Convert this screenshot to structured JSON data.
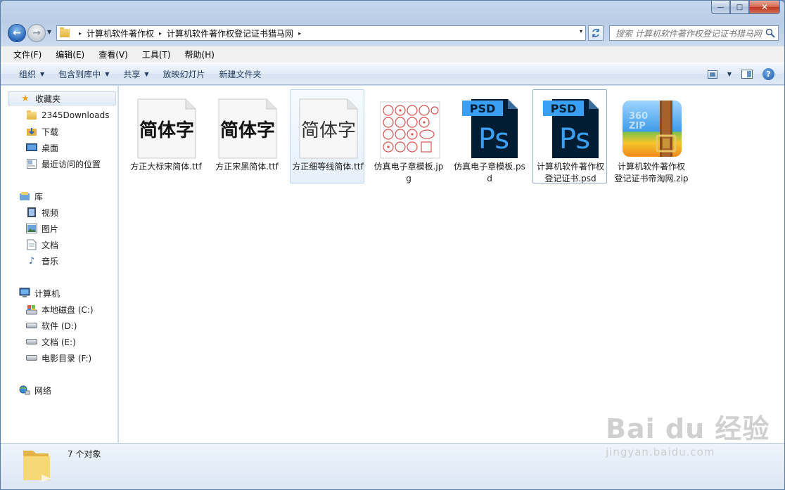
{
  "window": {
    "caption": {
      "minimize_label": "—",
      "maximize_label": "□",
      "close_label": "✕"
    }
  },
  "nav": {
    "back_label": "←",
    "forward_label": "→"
  },
  "address": {
    "breadcrumbs": [
      "计算机软件著作权",
      "计算机软件著作权登记证书猎马网"
    ],
    "separator": "▸",
    "dropdown": "▾"
  },
  "search": {
    "placeholder": "搜索 计算机软件著作权登记证书猎马网"
  },
  "menu": [
    "文件(F)",
    "编辑(E)",
    "查看(V)",
    "工具(T)",
    "帮助(H)"
  ],
  "toolbar": {
    "items": [
      {
        "label": "组织",
        "has_dropdown": true
      },
      {
        "label": "包含到库中",
        "has_dropdown": true
      },
      {
        "label": "共享",
        "has_dropdown": true
      },
      {
        "label": "放映幻灯片",
        "has_dropdown": false
      },
      {
        "label": "新建文件夹",
        "has_dropdown": false
      }
    ],
    "dropdown_glyph": "▼",
    "help_label": "?"
  },
  "sidebar": {
    "favorites": {
      "label": "收藏夹",
      "icon": "star-icon",
      "items": [
        "2345Downloads",
        "下载",
        "桌面",
        "最近访问的位置"
      ]
    },
    "libraries": {
      "label": "库",
      "icon": "library-icon",
      "items": [
        "视频",
        "图片",
        "文档",
        "音乐"
      ]
    },
    "computer": {
      "label": "计算机",
      "icon": "computer-icon",
      "items": [
        "本地磁盘 (C:)",
        "软件 (D:)",
        "文档 (E:)",
        "电影目录 (F:)"
      ]
    },
    "network": {
      "label": "网络",
      "icon": "network-icon"
    }
  },
  "files": [
    {
      "name": "方正大标宋简体.ttf",
      "type": "font",
      "preview_text": "简体字",
      "weight": "bold"
    },
    {
      "name": "方正宋黑简体.ttf",
      "type": "font",
      "preview_text": "简体字",
      "weight": "bold"
    },
    {
      "name": "方正细等线简体.ttf",
      "type": "font",
      "preview_text": "简体字",
      "weight": "light"
    },
    {
      "name": "仿真电子章模板.jpg",
      "type": "image"
    },
    {
      "name": "仿真电子章模板.psd",
      "type": "psd",
      "badge": "PSD",
      "logo": "Ps"
    },
    {
      "name": "计算机软件著作权登记证书.psd",
      "type": "psd",
      "badge": "PSD",
      "logo": "Ps"
    },
    {
      "name": "计算机软件著作权登记证书帝淘网.zip",
      "type": "zip",
      "zip_text": "360\nZIP"
    }
  ],
  "status": {
    "count_text": "7 个对象"
  },
  "watermark": {
    "logo": "Bai du 经验",
    "url": "jingyan.baidu.com"
  },
  "colors": {
    "psd_dark": "#001d34",
    "psd_blue": "#3aa0f6",
    "accent": "#2a66b8"
  }
}
